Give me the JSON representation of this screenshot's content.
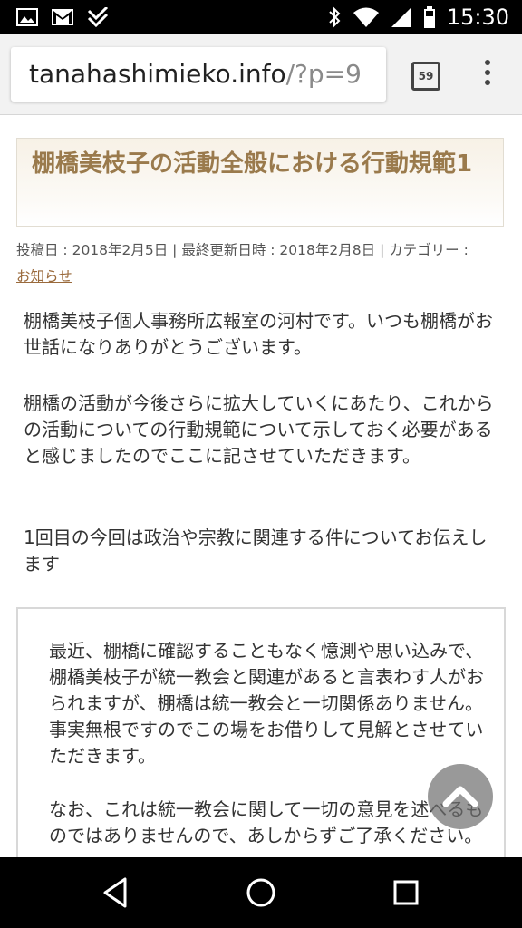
{
  "status_bar": {
    "time": "15:30",
    "icons": [
      "image-icon",
      "gmail-icon",
      "checkbox-icon",
      "bluetooth-icon",
      "wifi-icon",
      "signal-icon",
      "battery-icon"
    ]
  },
  "browser": {
    "url_domain": "tanahashimieko.info",
    "url_path": "/?p=9",
    "tab_count": "59"
  },
  "article": {
    "title": "棚橋美枝子の活動全般における行動規範1",
    "meta_posted": "投稿日 : 2018年2月5日 | 最終更新日時 : 2018年2月8日 | カテゴリー :",
    "category": "お知らせ",
    "paragraphs": [
      "棚橋美枝子個人事務所広報室の河村です。いつも棚橋がお世話になりありがとうございます。",
      "棚橋の活動が今後さらに拡大していくにあたり、これからの活動についての行動規範について示しておく必要があると感じましたのでここに記させていただきます。",
      "1回目の今回は政治や宗教に関連する件についてお伝えします"
    ],
    "box_paragraphs": [
      "最近、棚橋に確認することもなく憶測や思い込みで、棚橋美枝子が統一教会と関連があると言表わす人がおられますが、棚橋は統一教会と一切関係ありません。事実無根ですのでこの場をお借りして見解とさせていただきます。",
      "なお、これは統一教会に関して一切の意見を述べるものではありませんので、あしからずご了承ください。"
    ]
  },
  "colors": {
    "title": "#9a7a4c",
    "link": "#9a6a3c"
  }
}
